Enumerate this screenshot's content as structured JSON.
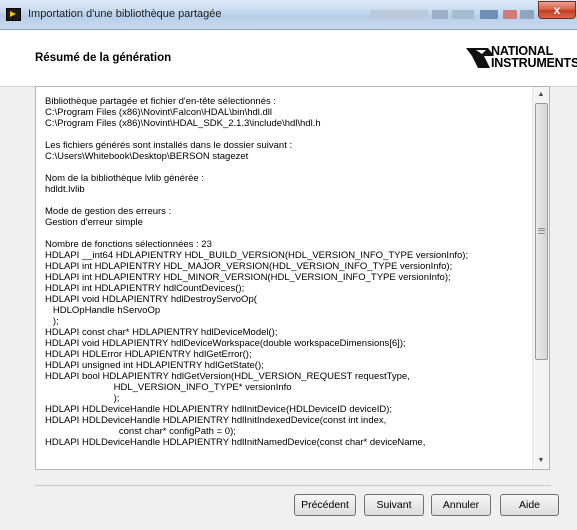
{
  "window": {
    "title": "Importation d'une bibliothèque partagée",
    "close_glyph": "x"
  },
  "header": {
    "title": "Résumé de la génération",
    "logo": {
      "line1": "NATIONAL",
      "line2": "INSTRUMENTS",
      "icon": "national-instruments-eagle-logo"
    }
  },
  "summary_lines": [
    "Bibliothèque partagée et fichier d'en-tête sélectionnés :",
    "C:\\Program Files (x86)\\Novint\\Falcon\\HDAL\\bin\\hdl.dll",
    "C:\\Program Files (x86)\\Novint\\HDAL_SDK_2.1.3\\include\\hdl\\hdl.h",
    "",
    "Les fichiers générés sont installés dans le dossier suivant :",
    "C:\\Users\\Whitebook\\Desktop\\BERSON stagezet",
    "",
    "Nom de la bibliothèque lvlib générée :",
    "hdldt.lvlib",
    "",
    "Mode de gestion des erreurs :",
    "Gestion d'erreur simple",
    "",
    "Nombre de fonctions sélectionnées : 23",
    "HDLAPI __int64 HDLAPIENTRY HDL_BUILD_VERSION(HDL_VERSION_INFO_TYPE versionInfo);",
    "HDLAPI int HDLAPIENTRY HDL_MAJOR_VERSION(HDL_VERSION_INFO_TYPE versionInfo);",
    "HDLAPI int HDLAPIENTRY HDL_MINOR_VERSION(HDL_VERSION_INFO_TYPE versionInfo);",
    "HDLAPI int HDLAPIENTRY hdlCountDevices();",
    "HDLAPI void HDLAPIENTRY hdlDestroyServoOp(",
    "   HDLOpHandle hServoOp",
    "   );",
    "HDLAPI const char* HDLAPIENTRY hdlDeviceModel();",
    "HDLAPI void HDLAPIENTRY hdlDeviceWorkspace(double workspaceDimensions[6]);",
    "HDLAPI HDLError HDLAPIENTRY hdlGetError();",
    "HDLAPI unsigned int HDLAPIENTRY hdlGetState();",
    "HDLAPI bool HDLAPIENTRY hdlGetVersion(HDL_VERSION_REQUEST requestType,",
    "                          HDL_VERSION_INFO_TYPE* versionInfo",
    "                          );",
    "HDLAPI HDLDeviceHandle HDLAPIENTRY hdlInitDevice(HDLDeviceID deviceID);",
    "HDLAPI HDLDeviceHandle HDLAPIENTRY hdlInitIndexedDevice(const int index,",
    "                            const char* configPath = 0);",
    "HDLAPI HDLDeviceHandle HDLAPIENTRY hdlInitNamedDevice(const char* deviceName,"
  ],
  "buttons": {
    "previous": "Précédent",
    "next": "Suivant",
    "cancel": "Annuler",
    "help": "Aide"
  },
  "scrollbar": {
    "position_fraction": 0.0
  }
}
